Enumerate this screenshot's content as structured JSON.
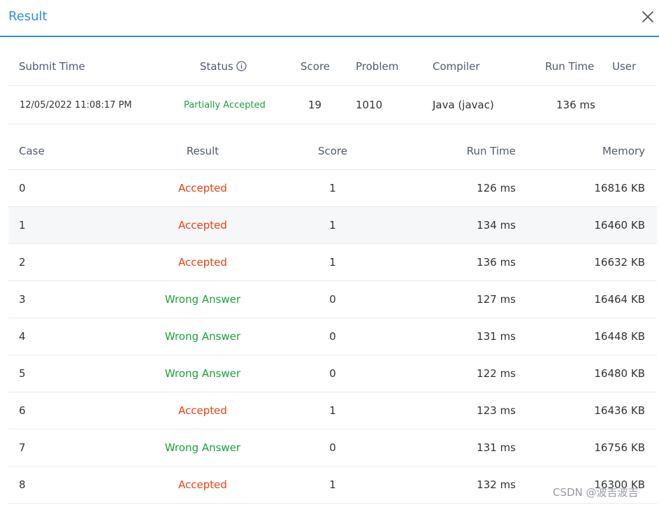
{
  "dialog": {
    "title": "Result",
    "close_icon": "close-icon"
  },
  "summary": {
    "headers": {
      "submit_time": "Submit Time",
      "status": "Status",
      "score": "Score",
      "problem": "Problem",
      "compiler": "Compiler",
      "run_time": "Run Time",
      "user": "User"
    },
    "row": {
      "submit_time": "12/05/2022 11:08:17 PM",
      "status": "Partially Accepted",
      "score": "19",
      "problem": "1010",
      "compiler": "Java (javac)",
      "run_time": "136 ms",
      "user": ""
    },
    "status_icon": "info-circle-icon"
  },
  "cases": {
    "headers": {
      "case": "Case",
      "result": "Result",
      "score": "Score",
      "run_time": "Run Time",
      "memory": "Memory"
    },
    "rows": [
      {
        "case": "0",
        "result": "Accepted",
        "score": "1",
        "run_time": "126 ms",
        "memory": "16816 KB"
      },
      {
        "case": "1",
        "result": "Accepted",
        "score": "1",
        "run_time": "134 ms",
        "memory": "16460 KB"
      },
      {
        "case": "2",
        "result": "Accepted",
        "score": "1",
        "run_time": "136 ms",
        "memory": "16632 KB"
      },
      {
        "case": "3",
        "result": "Wrong Answer",
        "score": "0",
        "run_time": "127 ms",
        "memory": "16464 KB"
      },
      {
        "case": "4",
        "result": "Wrong Answer",
        "score": "0",
        "run_time": "131 ms",
        "memory": "16448 KB"
      },
      {
        "case": "5",
        "result": "Wrong Answer",
        "score": "0",
        "run_time": "122 ms",
        "memory": "16480 KB"
      },
      {
        "case": "6",
        "result": "Accepted",
        "score": "1",
        "run_time": "123 ms",
        "memory": "16436 KB"
      },
      {
        "case": "7",
        "result": "Wrong Answer",
        "score": "0",
        "run_time": "131 ms",
        "memory": "16756 KB"
      },
      {
        "case": "8",
        "result": "Accepted",
        "score": "1",
        "run_time": "132 ms",
        "memory": "16300 KB"
      }
    ]
  },
  "colors": {
    "accent": "#2d8cf0",
    "accepted": "#ed4014",
    "wrong_answer": "#19a337",
    "partially_accepted": "#19a337"
  },
  "watermark": "CSDN @波吉波吉"
}
